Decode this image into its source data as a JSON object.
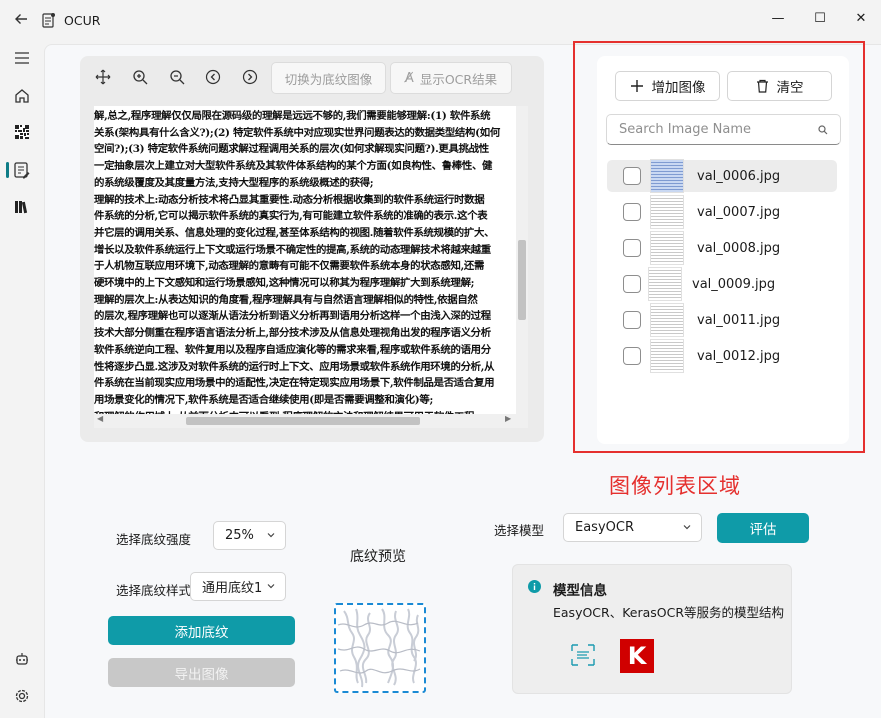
{
  "app": {
    "title": "OCUR"
  },
  "window": {
    "minimize": "—",
    "maximize": "☐",
    "close": "✕"
  },
  "rail": {
    "items": [
      {
        "icon": "menu-icon"
      },
      {
        "icon": "home-icon"
      },
      {
        "icon": "qr-icon"
      },
      {
        "icon": "document-edit-icon",
        "active": true
      },
      {
        "icon": "library-icon"
      }
    ],
    "bottom": [
      {
        "icon": "robot-icon"
      },
      {
        "icon": "settings-icon"
      }
    ]
  },
  "viewer": {
    "toggle_watermark_label": "切换为底纹图像",
    "show_ocr_label": "显示OCR结果",
    "document_lines": [
      "解,总之,程序理解仅仅局限在源码级的理解是远远不够的,我们需要能够理解:(1)  软件系统",
      "关系(架构具有什么含义?);(2) 特定软件系统中对应现实世界问题表达的数据类型结构(如何",
      "空间?);(3) 特定软件系统问题求解过程调用关系的层次(如何求解现实问题?).更具挑战性",
      "一定抽象层次上建立对大型软件系统及其软件体系结构的某个方面(如良构性、鲁棒性、健",
      "的系统级覆度及其度量方法,支持大型程序的系统级概述的获得;",
      "理解的技术上:动态分析技术将凸显其重要性.动态分析根据收集到的软件系统运行时数据",
      "件系统的分析,它可以揭示软件系统的真实行为,有可能建立软件系统的准确的表示.这个表",
      "并它层的调用关系、信息处理的变化过程,甚至体系结构的视图.随着软件系统规模的扩大、",
      "增长以及软件系统运行上下文或运行场景不确定性的提高,系统的动态理解技术将越来越重",
      "于人机物互联应用环境下,动态理解的意畴有可能不仅需要软件系统本身的状态感知,还需",
      "硬环境中的上下文感知和运行场景感知,这种情况可以称其为程序理解扩大到系统理解;",
      "理解的层次上:从表达知识的角度看,程序理解具有与自然语言理解相似的特性,依据自然",
      "的层次,程序理解也可以逐渐从语法分析到语义分析再到语用分析这样一个由浅入深的过程",
      "技术大部分侧重在程序语言语法分析上,部分技术涉及从信息处理视角出发的程序语义分析",
      "软件系统逆向工程、软件复用以及程序自适应演化等的需求来看,程序或软件系统的语用分",
      "性将逐步凸显.这涉及对软件系统的运行时上下文、应用场景或软件系统作用环境的分析,从",
      "件系统在当前现实应用场景中的适配性,决定在特定现实应用场景下,软件制品是否适合复用",
      "用场景变化的情况下,软件系统是否适合继续使用(即是否需要调整和演化)等;",
      "和理解的作用域上:从前面分析中可以看到,程序理解的方法和理解结果可用于软件工程"
    ]
  },
  "image_list": {
    "add_label": "增加图像",
    "clear_label": "清空",
    "search_placeholder": "Search Image Name",
    "items": [
      {
        "name": "val_0006.jpg",
        "selected": true
      },
      {
        "name": "val_0007.jpg",
        "selected": false
      },
      {
        "name": "val_0008.jpg",
        "selected": false
      },
      {
        "name": "val_0009.jpg",
        "selected": false
      },
      {
        "name": "val_0011.jpg",
        "selected": false
      },
      {
        "name": "val_0012.jpg",
        "selected": false
      }
    ],
    "annotation": "图像列表区域"
  },
  "watermark": {
    "strength_label": "选择底纹强度",
    "strength_value": "25%",
    "style_label": "选择底纹样式",
    "style_value": "通用底纹1",
    "add_label": "添加底纹",
    "export_label": "导出图像",
    "preview_title": "底纹预览"
  },
  "model": {
    "select_label": "选择模型",
    "selected": "EasyOCR",
    "evaluate_label": "评估",
    "info_title": "模型信息",
    "info_text": "EasyOCR、KerasOCR等服务的模型结构",
    "logo_letter": "K"
  },
  "colors": {
    "accent": "#0f9ba8",
    "annotation": "#e5302e",
    "keras": "#d00000"
  }
}
